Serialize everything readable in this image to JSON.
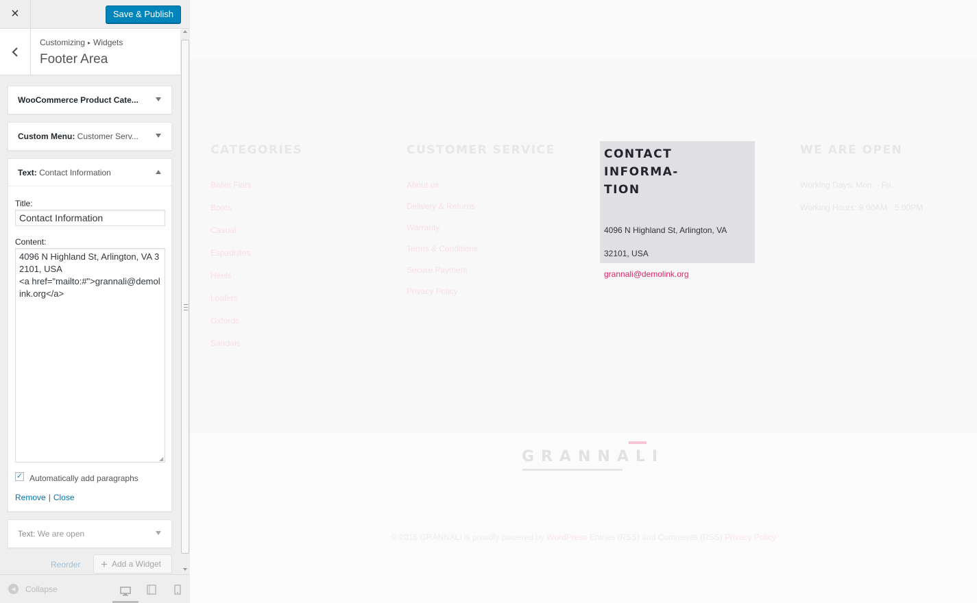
{
  "topbar": {
    "close_icon": "×",
    "save_label": "Save & Publish"
  },
  "section": {
    "breadcrumb_root": "Customizing",
    "breadcrumb_sep": "▸",
    "breadcrumb_current": "Widgets",
    "title": "Footer Area"
  },
  "widgets": [
    {
      "type": "WooCommerce Product Cate...",
      "subtitle": ""
    },
    {
      "type": "Custom Menu:",
      "subtitle": "Customer Serv..."
    },
    {
      "type": "Text:",
      "subtitle": "Contact Information"
    },
    {
      "type": "Text:",
      "subtitle": "We are open"
    }
  ],
  "text_widget_form": {
    "title_label": "Title:",
    "title_value": "Contact Information",
    "content_label": "Content:",
    "content_value": "4096 N Highland St, Arlington, VA 32101, USA\n<a href=\"mailto:#\">grannali@demolink.org</a>",
    "autop_label": "Automatically add paragraphs",
    "autop_checked": "✓",
    "remove_label": "Remove",
    "separator": "|",
    "close_label": "Close"
  },
  "widget_actions": {
    "reorder_label": "Reorder",
    "add_icon": "+",
    "add_label": "Add a Widget"
  },
  "footer_bar": {
    "collapse_label": "Collapse"
  },
  "preview": {
    "categories": {
      "heading": "CATEGORIES",
      "items": [
        "Ballet Flats",
        "Boots",
        "Casual",
        "Espadrilles",
        "Heels",
        "Loafers",
        "Oxfords",
        "Sandals"
      ]
    },
    "customer_service": {
      "heading": "CUSTOMER SERVICE",
      "items": [
        "About us",
        "Delivery & Returns",
        "Warranty",
        "Terms & Conditions",
        "Secure Payment",
        "Privacy Policy"
      ]
    },
    "contact": {
      "heading_line1": "CONTACT INFORMA-",
      "heading_line2": "TION",
      "address_line1": "4096 N Highland St, Arlington, VA",
      "address_line2": "32101, USA",
      "email": "grannali@demolink.org"
    },
    "open": {
      "heading": "WE ARE OPEN",
      "days": "Working Days: Mon. - Fri.",
      "hours": "Working Hours: 9.00AM - 5.00PM"
    },
    "logo": "GRANNALI",
    "copyright_prefix": "© 2016 GRANNALI is proudly powered by ",
    "copyright_wp": "WordPress",
    "copyright_middle": " Entries (RSS) and Comments (RSS) ",
    "copyright_privacy": "Privacy Policy"
  },
  "colors": {
    "primary_button": "#0085ba",
    "link": "#0073aa",
    "accent_pink": "#e0245e",
    "highlight_bg": "#e0e0e4"
  }
}
